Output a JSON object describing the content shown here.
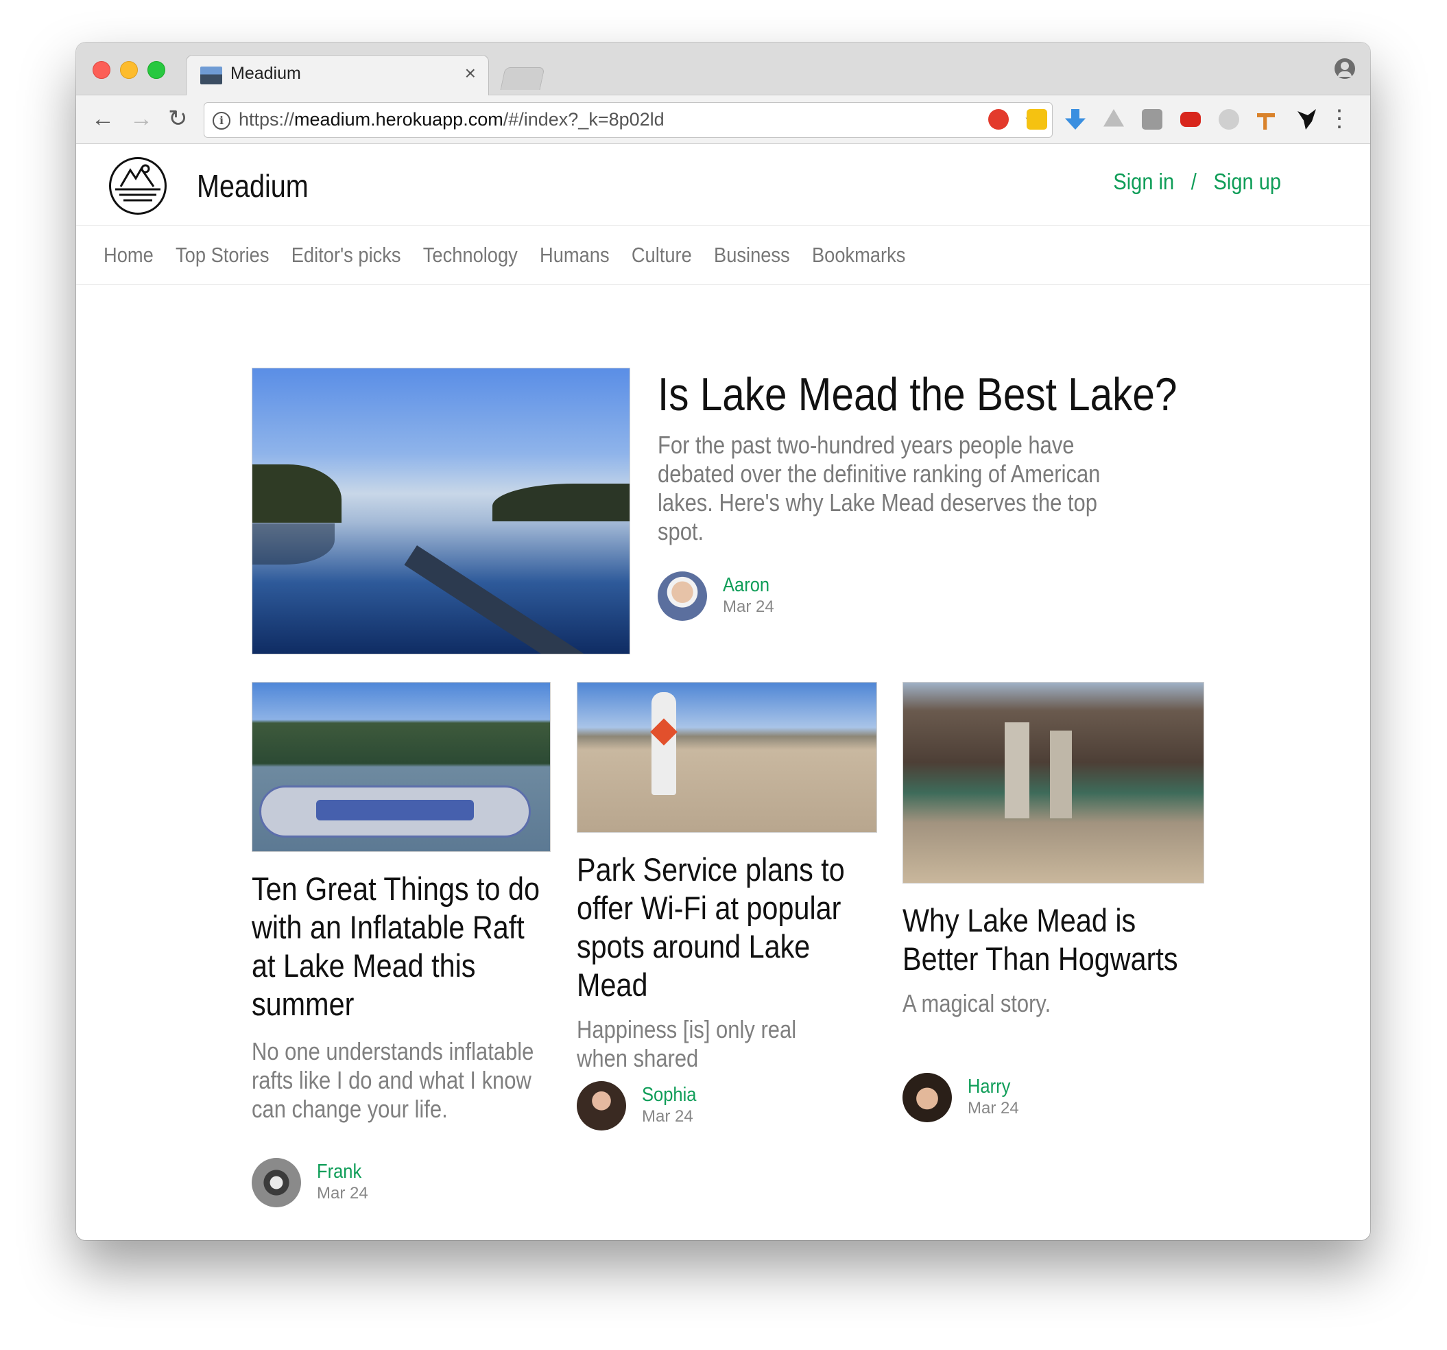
{
  "browser": {
    "tab_title": "Meadium",
    "tab_close": "×",
    "url_scheme": "https://",
    "url_host": "meadium.herokuapp.com",
    "url_path": "/#/index?_k=8p02ld",
    "back_glyph": "←",
    "forward_glyph": "→",
    "reload_glyph": "↻",
    "star_glyph": "☆",
    "menu_glyph": "⋮",
    "info_glyph": "i",
    "extensions": [
      "adblock-icon",
      "clipper-icon",
      "download-icon",
      "drive-icon",
      "medium-icon",
      "youtube-icon",
      "react-icon",
      "ruler-icon",
      "bird-icon"
    ]
  },
  "site": {
    "brand": "Meadium",
    "sign_in": "Sign in",
    "separator": "/",
    "sign_up": "Sign up",
    "accent_color": "#0f9d58"
  },
  "nav": {
    "items": [
      "Home",
      "Top Stories",
      "Editor's picks",
      "Technology",
      "Humans",
      "Culture",
      "Business",
      "Bookmarks"
    ]
  },
  "featured": {
    "title": "Is Lake Mead the Best Lake?",
    "excerpt": "For the past two-hundred years people have debated over the definitive ranking of American lakes. Here's why Lake Mead deserves the top spot.",
    "author": "Aaron",
    "date": "Mar 24"
  },
  "cards": [
    {
      "title": "Ten Great Things to do with an Inflatable Raft at Lake Mead this summer",
      "excerpt": "No one understands inflatable rafts like I do and what I know can change your life.",
      "author": "Frank",
      "date": "Mar 24"
    },
    {
      "title": "Park Service plans to offer Wi-Fi at popular spots around Lake Mead",
      "excerpt": "Happiness [is] only real when shared",
      "author": "Sophia",
      "date": "Mar 24"
    },
    {
      "title": "Why Lake Mead is Better Than Hogwarts",
      "excerpt": "A magical story.",
      "author": "Harry",
      "date": "Mar 24"
    }
  ]
}
